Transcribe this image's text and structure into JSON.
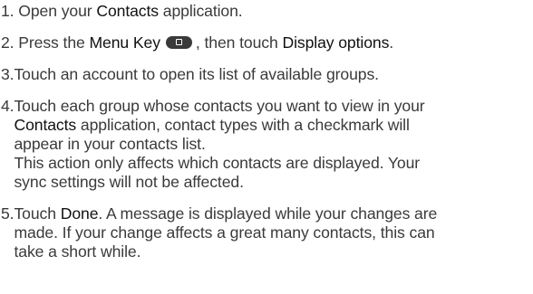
{
  "steps": [
    {
      "number": "1.",
      "parts": {
        "a": "Open your",
        "b": "Contacts",
        "c": "application."
      }
    },
    {
      "number": "2.",
      "parts": {
        "a": "Press the",
        "b": "Menu Key",
        "c": ", then touch",
        "d": "Display options",
        "e": "."
      },
      "icon": "menu-key-icon"
    },
    {
      "number": "3.",
      "text": "Touch an account to open its list of available groups."
    },
    {
      "number": "4.",
      "lines": {
        "l1": "Touch each group whose contacts you want to view in your",
        "l2_b": "Contacts",
        "l2_c": "application, contact types with a checkmark will",
        "l3": "appear in your contacts list.",
        "l4": "This action only affects which contacts are displayed. Your",
        "l5": "sync settings will not be affected."
      }
    },
    {
      "number": "5.",
      "lines": {
        "l1_a": "Touch",
        "l1_b": "Done",
        "l1_c": ". A message is displayed while your changes are",
        "l2": "made. If your change affects a great many contacts, this can",
        "l3": "take a short while."
      }
    }
  ]
}
